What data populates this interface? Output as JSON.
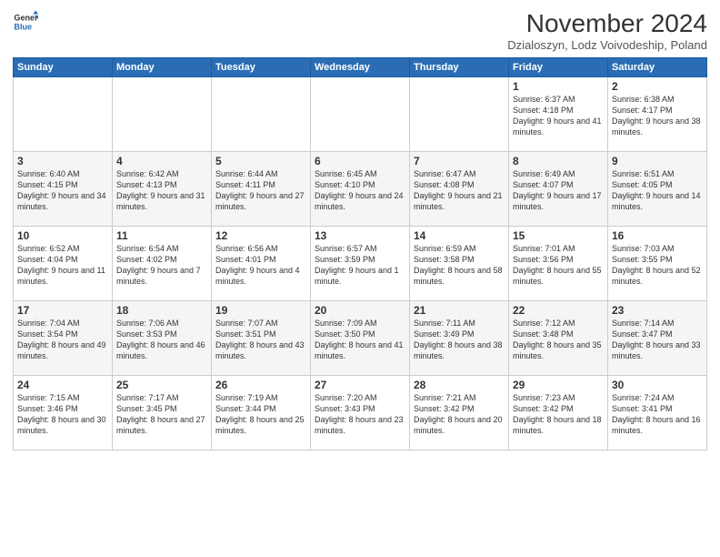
{
  "logo": {
    "general": "General",
    "blue": "Blue"
  },
  "title": "November 2024",
  "subtitle": "Dzialoszyn, Lodz Voivodeship, Poland",
  "days_of_week": [
    "Sunday",
    "Monday",
    "Tuesday",
    "Wednesday",
    "Thursday",
    "Friday",
    "Saturday"
  ],
  "weeks": [
    [
      {
        "day": "",
        "info": ""
      },
      {
        "day": "",
        "info": ""
      },
      {
        "day": "",
        "info": ""
      },
      {
        "day": "",
        "info": ""
      },
      {
        "day": "",
        "info": ""
      },
      {
        "day": "1",
        "info": "Sunrise: 6:37 AM\nSunset: 4:18 PM\nDaylight: 9 hours\nand 41 minutes."
      },
      {
        "day": "2",
        "info": "Sunrise: 6:38 AM\nSunset: 4:17 PM\nDaylight: 9 hours\nand 38 minutes."
      }
    ],
    [
      {
        "day": "3",
        "info": "Sunrise: 6:40 AM\nSunset: 4:15 PM\nDaylight: 9 hours\nand 34 minutes."
      },
      {
        "day": "4",
        "info": "Sunrise: 6:42 AM\nSunset: 4:13 PM\nDaylight: 9 hours\nand 31 minutes."
      },
      {
        "day": "5",
        "info": "Sunrise: 6:44 AM\nSunset: 4:11 PM\nDaylight: 9 hours\nand 27 minutes."
      },
      {
        "day": "6",
        "info": "Sunrise: 6:45 AM\nSunset: 4:10 PM\nDaylight: 9 hours\nand 24 minutes."
      },
      {
        "day": "7",
        "info": "Sunrise: 6:47 AM\nSunset: 4:08 PM\nDaylight: 9 hours\nand 21 minutes."
      },
      {
        "day": "8",
        "info": "Sunrise: 6:49 AM\nSunset: 4:07 PM\nDaylight: 9 hours\nand 17 minutes."
      },
      {
        "day": "9",
        "info": "Sunrise: 6:51 AM\nSunset: 4:05 PM\nDaylight: 9 hours\nand 14 minutes."
      }
    ],
    [
      {
        "day": "10",
        "info": "Sunrise: 6:52 AM\nSunset: 4:04 PM\nDaylight: 9 hours\nand 11 minutes."
      },
      {
        "day": "11",
        "info": "Sunrise: 6:54 AM\nSunset: 4:02 PM\nDaylight: 9 hours\nand 7 minutes."
      },
      {
        "day": "12",
        "info": "Sunrise: 6:56 AM\nSunset: 4:01 PM\nDaylight: 9 hours\nand 4 minutes."
      },
      {
        "day": "13",
        "info": "Sunrise: 6:57 AM\nSunset: 3:59 PM\nDaylight: 9 hours\nand 1 minute."
      },
      {
        "day": "14",
        "info": "Sunrise: 6:59 AM\nSunset: 3:58 PM\nDaylight: 8 hours\nand 58 minutes."
      },
      {
        "day": "15",
        "info": "Sunrise: 7:01 AM\nSunset: 3:56 PM\nDaylight: 8 hours\nand 55 minutes."
      },
      {
        "day": "16",
        "info": "Sunrise: 7:03 AM\nSunset: 3:55 PM\nDaylight: 8 hours\nand 52 minutes."
      }
    ],
    [
      {
        "day": "17",
        "info": "Sunrise: 7:04 AM\nSunset: 3:54 PM\nDaylight: 8 hours\nand 49 minutes."
      },
      {
        "day": "18",
        "info": "Sunrise: 7:06 AM\nSunset: 3:53 PM\nDaylight: 8 hours\nand 46 minutes."
      },
      {
        "day": "19",
        "info": "Sunrise: 7:07 AM\nSunset: 3:51 PM\nDaylight: 8 hours\nand 43 minutes."
      },
      {
        "day": "20",
        "info": "Sunrise: 7:09 AM\nSunset: 3:50 PM\nDaylight: 8 hours\nand 41 minutes."
      },
      {
        "day": "21",
        "info": "Sunrise: 7:11 AM\nSunset: 3:49 PM\nDaylight: 8 hours\nand 38 minutes."
      },
      {
        "day": "22",
        "info": "Sunrise: 7:12 AM\nSunset: 3:48 PM\nDaylight: 8 hours\nand 35 minutes."
      },
      {
        "day": "23",
        "info": "Sunrise: 7:14 AM\nSunset: 3:47 PM\nDaylight: 8 hours\nand 33 minutes."
      }
    ],
    [
      {
        "day": "24",
        "info": "Sunrise: 7:15 AM\nSunset: 3:46 PM\nDaylight: 8 hours\nand 30 minutes."
      },
      {
        "day": "25",
        "info": "Sunrise: 7:17 AM\nSunset: 3:45 PM\nDaylight: 8 hours\nand 27 minutes."
      },
      {
        "day": "26",
        "info": "Sunrise: 7:19 AM\nSunset: 3:44 PM\nDaylight: 8 hours\nand 25 minutes."
      },
      {
        "day": "27",
        "info": "Sunrise: 7:20 AM\nSunset: 3:43 PM\nDaylight: 8 hours\nand 23 minutes."
      },
      {
        "day": "28",
        "info": "Sunrise: 7:21 AM\nSunset: 3:42 PM\nDaylight: 8 hours\nand 20 minutes."
      },
      {
        "day": "29",
        "info": "Sunrise: 7:23 AM\nSunset: 3:42 PM\nDaylight: 8 hours\nand 18 minutes."
      },
      {
        "day": "30",
        "info": "Sunrise: 7:24 AM\nSunset: 3:41 PM\nDaylight: 8 hours\nand 16 minutes."
      }
    ]
  ]
}
